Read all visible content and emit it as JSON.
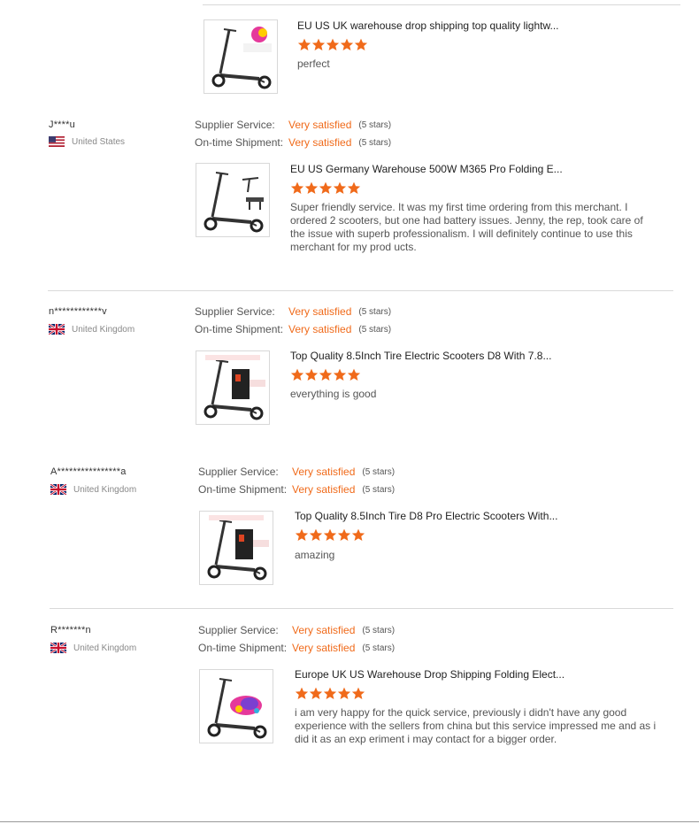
{
  "labels": {
    "supplier": "Supplier Service:",
    "shipment": "On-time Shipment:"
  },
  "colors": {
    "accent": "#f06a1a",
    "divider": "#d9d9d9"
  },
  "reviews": [
    {
      "name": "",
      "country": "",
      "supplier_value": "",
      "supplier_stars": "",
      "shipment_value": "",
      "shipment_stars": "",
      "product_title": "EU US UK warehouse drop shipping top quality lightw...",
      "rating": 5,
      "comment": "perfect",
      "thumb_icon": "scooter-2020-badge-icon"
    },
    {
      "name": "J****u",
      "country": "United States",
      "flag_icon": "us-flag-icon",
      "supplier_value": "Very satisfied",
      "supplier_stars": "(5 stars)",
      "shipment_value": "Very satisfied",
      "shipment_stars": "(5 stars)",
      "product_title": "EU US Germany Warehouse 500W M365 Pro Folding E...",
      "rating": 5,
      "comment": "Super friendly service. It was my first time ordering from this merchant. I ordered 2 scooters, but one had battery issues. Jenny, the rep, took care of the issue with superb professionalism. I will definitely continue to use this merchant for my prod ucts.",
      "thumb_icon": "scooter-parts-icon"
    },
    {
      "name": "n************v",
      "country": "United Kingdom",
      "flag_icon": "uk-flag-icon",
      "supplier_value": "Very satisfied",
      "supplier_stars": "(5 stars)",
      "shipment_value": "Very satisfied",
      "shipment_stars": "(5 stars)",
      "product_title": "Top Quality 8.5Inch Tire Electric Scooters D8 With 7.8...",
      "rating": 5,
      "comment": "everything is good",
      "thumb_icon": "scooter-warehouse-icon"
    },
    {
      "name": "A****************a",
      "country": "United Kingdom",
      "flag_icon": "uk-flag-icon",
      "supplier_value": "Very satisfied",
      "supplier_stars": "(5 stars)",
      "shipment_value": "Very satisfied",
      "shipment_stars": "(5 stars)",
      "product_title": "Top Quality 8.5Inch Tire D8 Pro Electric Scooters With...",
      "rating": 5,
      "comment": "amazing",
      "thumb_icon": "scooter-warehouse-icon"
    },
    {
      "name": "R*******n",
      "country": "United Kingdom",
      "flag_icon": "uk-flag-icon",
      "supplier_value": "Very satisfied",
      "supplier_stars": "(5 stars)",
      "shipment_value": "Very satisfied",
      "shipment_stars": "(5 stars)",
      "product_title": "Europe UK US Warehouse Drop Shipping Folding Elect...",
      "rating": 5,
      "comment": "i am very happy for the quick service, previously i didn't have any good experience with the sellers from china but this service impressed me and as i did it as an exp eriment i may contact for a bigger order.",
      "thumb_icon": "scooter-2020-badge-icon"
    }
  ]
}
